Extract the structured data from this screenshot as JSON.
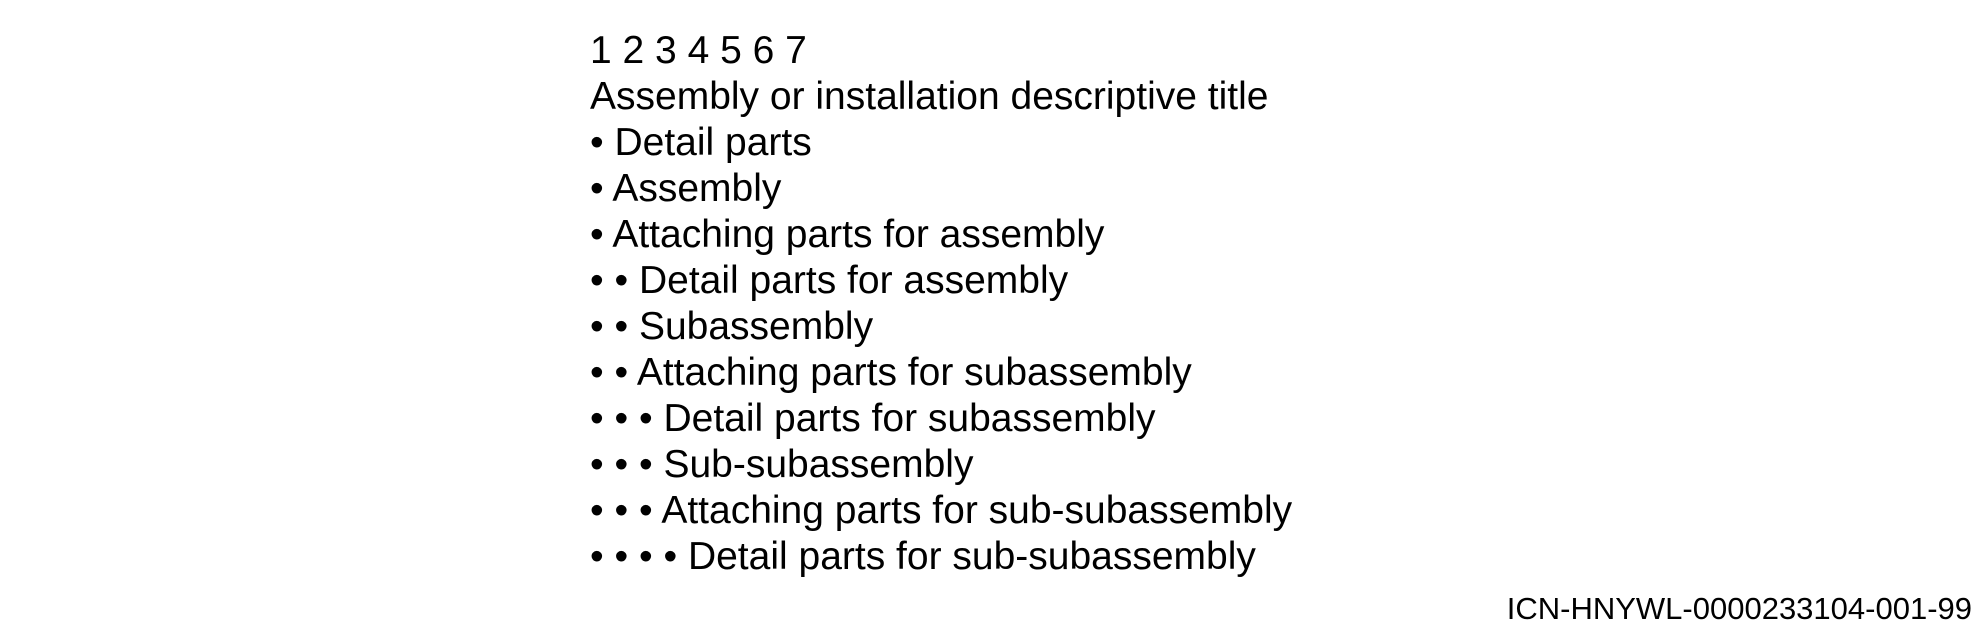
{
  "document": {
    "indent_scale": "1 2 3 4 5 6 7",
    "lines": [
      "Assembly or installation descriptive title",
      "• Detail parts",
      "• Assembly",
      "• Attaching parts for assembly",
      "• • Detail parts for assembly",
      "• • Subassembly",
      "• • Attaching parts for subassembly",
      "• • • Detail parts for subassembly",
      "• • • Sub-subassembly",
      "• • • Attaching parts for sub-subassembly",
      "• • • • Detail parts for sub-subassembly"
    ],
    "icn": "ICN-HNYWL-0000233104-001-99"
  }
}
